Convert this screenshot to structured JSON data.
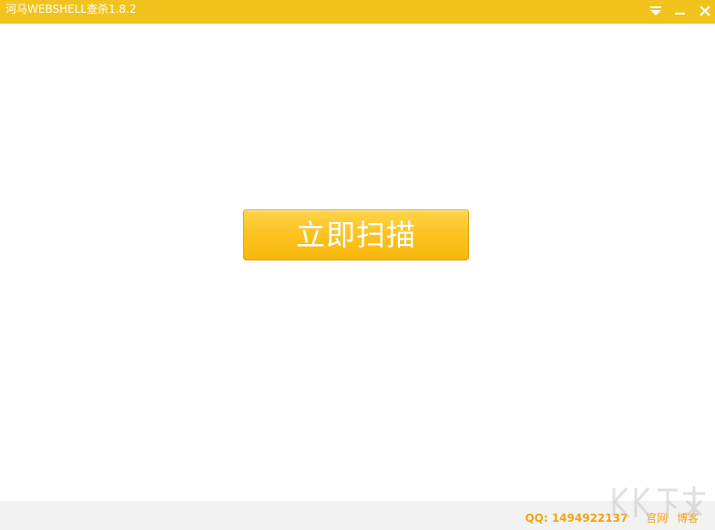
{
  "window": {
    "title": "河马WEBSHELL查杀1.8.2"
  },
  "main": {
    "scan_button_label": "立即扫描"
  },
  "footer": {
    "qq": "QQ: 1494922137",
    "links": [
      "官网",
      "博客"
    ]
  },
  "icons": {
    "menu": "dropdown-menu-icon",
    "minimize": "minimize-icon",
    "close": "close-icon"
  },
  "colors": {
    "titlebar": "#f2c31d",
    "accent": "#fcc21f",
    "footer_text": "#f5a30a",
    "footer_bg": "#f2f2f2"
  }
}
